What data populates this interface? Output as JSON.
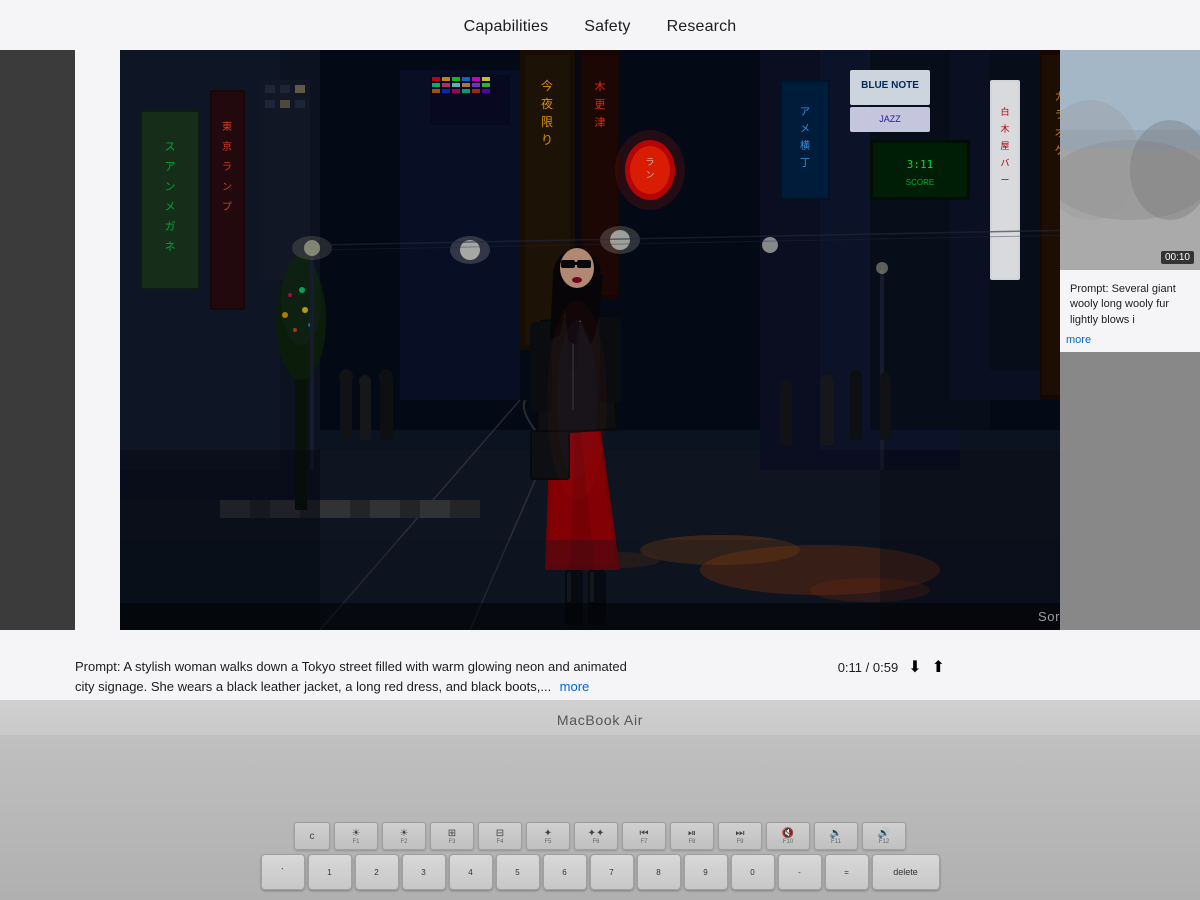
{
  "nav": {
    "items": [
      {
        "label": "Capabilities",
        "id": "capabilities"
      },
      {
        "label": "Safety",
        "id": "safety"
      },
      {
        "label": "Research",
        "id": "research"
      }
    ]
  },
  "main_video": {
    "watermark": "Sora",
    "time_current": "0:11",
    "time_total": "0:59",
    "prompt": "Prompt: A stylish woman walks down a Tokyo street filled with warm glowing neon and animated city signage. She wears a black leather jacket, a long red dress, and black boots,...",
    "more_label": "more",
    "controls": {
      "time_display": "0:11 / 0:59",
      "download_icon": "⬇",
      "share_icon": "⬆"
    }
  },
  "right_video": {
    "time": "00:10",
    "prompt": "Prompt: Several giant wooly long wooly fur lightly blows i",
    "more_label": "more"
  },
  "macbook": {
    "label": "MacBook Air"
  },
  "keyboard": {
    "fn_keys": [
      {
        "icon": "☀",
        "label": "F1"
      },
      {
        "icon": "☀",
        "label": "F2"
      },
      {
        "icon": "⊞",
        "label": "F3"
      },
      {
        "icon": "⊟",
        "label": "F4"
      },
      {
        "icon": "✦",
        "label": "F5"
      },
      {
        "icon": "✦✦",
        "label": "F6"
      },
      {
        "icon": "⏮",
        "label": "F7"
      },
      {
        "icon": "⏯",
        "label": "F8"
      },
      {
        "icon": "⏭",
        "label": "F9"
      },
      {
        "icon": "🔇",
        "label": "F10"
      },
      {
        "icon": "🔉",
        "label": "F11"
      },
      {
        "icon": "🔊",
        "label": "F12"
      }
    ]
  },
  "colors": {
    "screen_bg": "#f5f5f7",
    "nav_text": "#1d1d1f",
    "accent_blue": "#0066cc",
    "video_bg": "#0a0a12",
    "keyboard_bg": "#c0c0c0"
  }
}
